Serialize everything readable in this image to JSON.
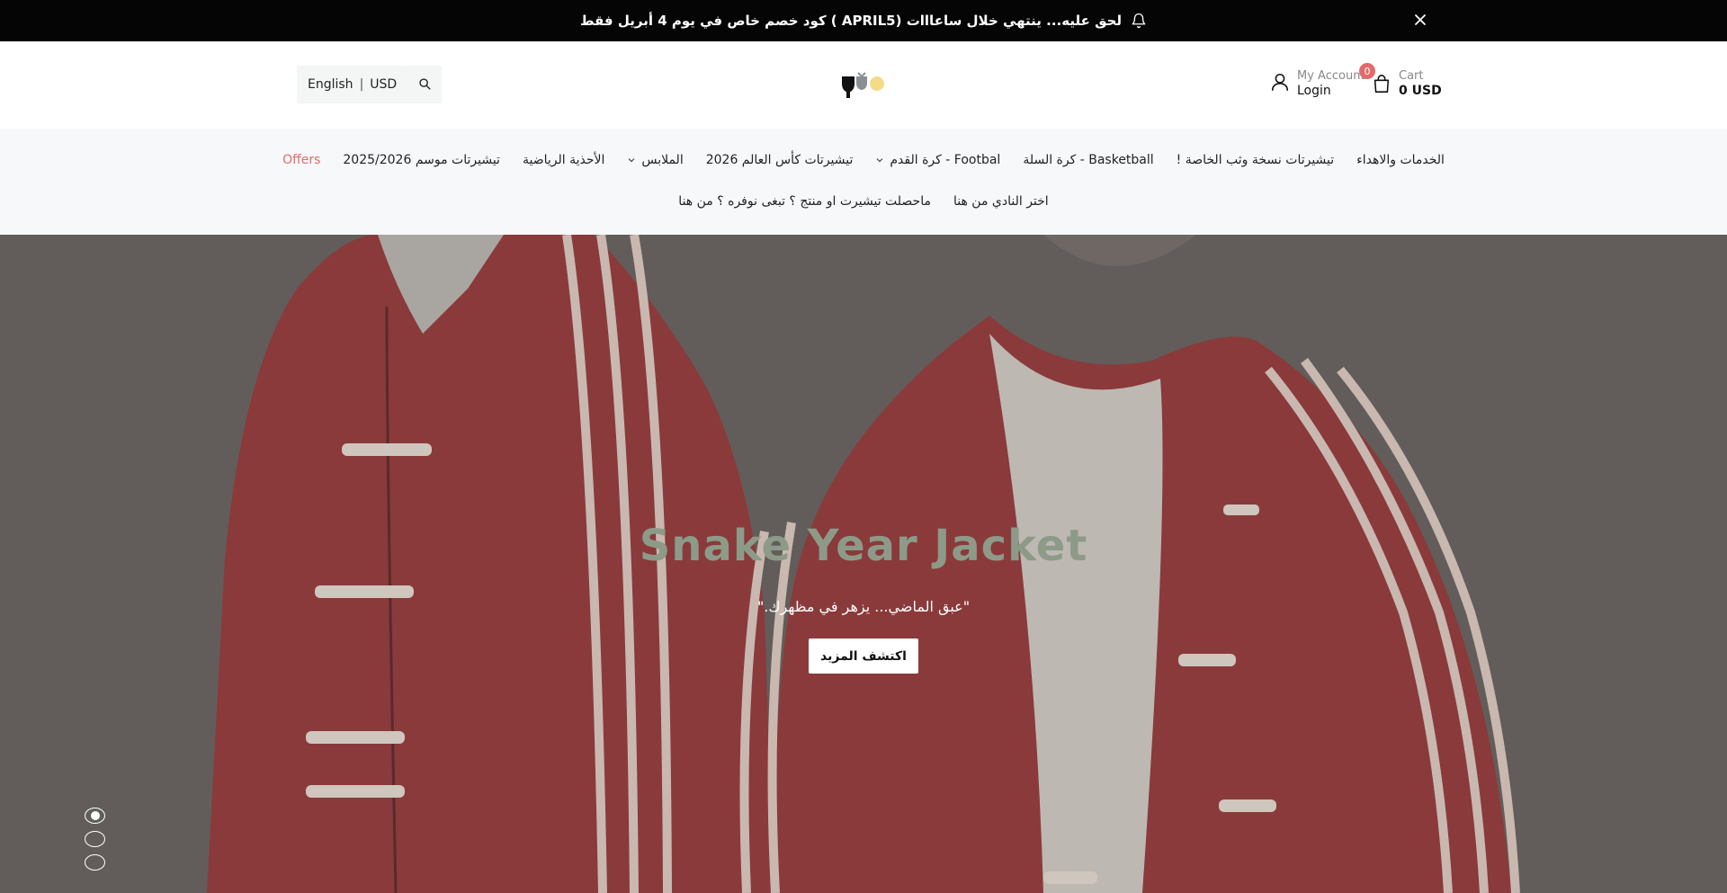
{
  "announcement": {
    "text": "لحق عليه... ينتهي خلال ساعااات (APRIL5 ) كود خصم خاص في يوم 4 أبريل فقط",
    "bell_icon": "bell-icon",
    "close_icon": "close-icon"
  },
  "header": {
    "language": "English",
    "separator": "|",
    "currency": "USD",
    "search_icon": "search-icon",
    "account": {
      "top": "My Account",
      "bottom": "Login",
      "icon": "user-icon"
    },
    "cart": {
      "top": "Cart",
      "bottom": "0 USD",
      "count": "0",
      "icon": "bag-icon"
    }
  },
  "nav": {
    "row1": [
      {
        "label": "الخدمات والاهداء",
        "dropdown": false
      },
      {
        "label": "تيشيرتات نسخة وثب الخاصة !",
        "dropdown": false
      },
      {
        "label": "Basketball - كرة السلة",
        "dropdown": false
      },
      {
        "label": "Footbal - كرة القدم",
        "dropdown": true
      },
      {
        "label": "تيشيرتات كأس العالم 2026",
        "dropdown": false
      },
      {
        "label": "الملابس",
        "dropdown": true
      },
      {
        "label": "الأحذية الرياضية",
        "dropdown": false
      },
      {
        "label": "تيشيرتات موسم 2025/2026",
        "dropdown": false
      },
      {
        "label": "Offers",
        "dropdown": false,
        "highlight": "#e46a6a"
      }
    ],
    "row2": [
      {
        "label": "اختر النادي من هنا"
      },
      {
        "label": "ماحصلت تيشيرت او منتج ؟ تبغى نوفره ؟ من هنا"
      }
    ]
  },
  "hero": {
    "title": "Snake Year Jacket",
    "subtitle": "\"عبق الماضي... يزهر في مظهرك.\"",
    "button": "اكتشف المزيد",
    "slides": 3,
    "active_slide": 1
  },
  "colors": {
    "announce_bg": "#050505",
    "nav_bg": "#f6f8fa",
    "accent": "#e46a6a",
    "hero_title": "#8d9a88"
  }
}
